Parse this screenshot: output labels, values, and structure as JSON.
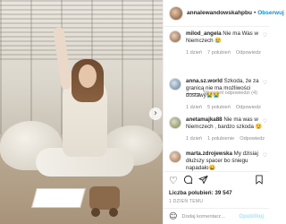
{
  "post": {
    "username": "annalewandowskahpbu",
    "separator": "•",
    "follow_label": "Obserwuj"
  },
  "comments": [
    {
      "username": "milod_angela",
      "text": "Nie ma Was w Niemczech 😢",
      "time": "1 dzień",
      "likes": "7 polubień",
      "reply": "Odpowiedz",
      "view_replies": "Wyświetl odpowiedzi (4)"
    },
    {
      "username": "anna.sz.world",
      "text": "Szkoda, że za granicą nie ma możliwości dostawy😭😭",
      "time": "1 dzień",
      "likes": "5 polubień",
      "reply": "Odpowiedz"
    },
    {
      "username": "anetamajka88",
      "text": "Nie ma was w Niemczech , bardzo szkoda 😟",
      "time": "1 dzień",
      "likes": "1 polubienie",
      "reply": "Odpowiedz"
    },
    {
      "username": "marta.zdrojewska",
      "text": "My dzisiaj dłuższy spacer bo śniegu napadało😀",
      "time": "",
      "likes": "",
      "reply": ""
    }
  ],
  "actions": {
    "like_icon": "heart-icon",
    "comment_icon": "comment-icon",
    "share_icon": "share-icon",
    "save_icon": "bookmark-icon"
  },
  "likes_text": "Liczba polubień: 39 547",
  "date_text": "1 DZIEŃ TEMU",
  "add_comment": {
    "placeholder": "Dodaj komentarz...",
    "post_label": "Opublikuj"
  }
}
